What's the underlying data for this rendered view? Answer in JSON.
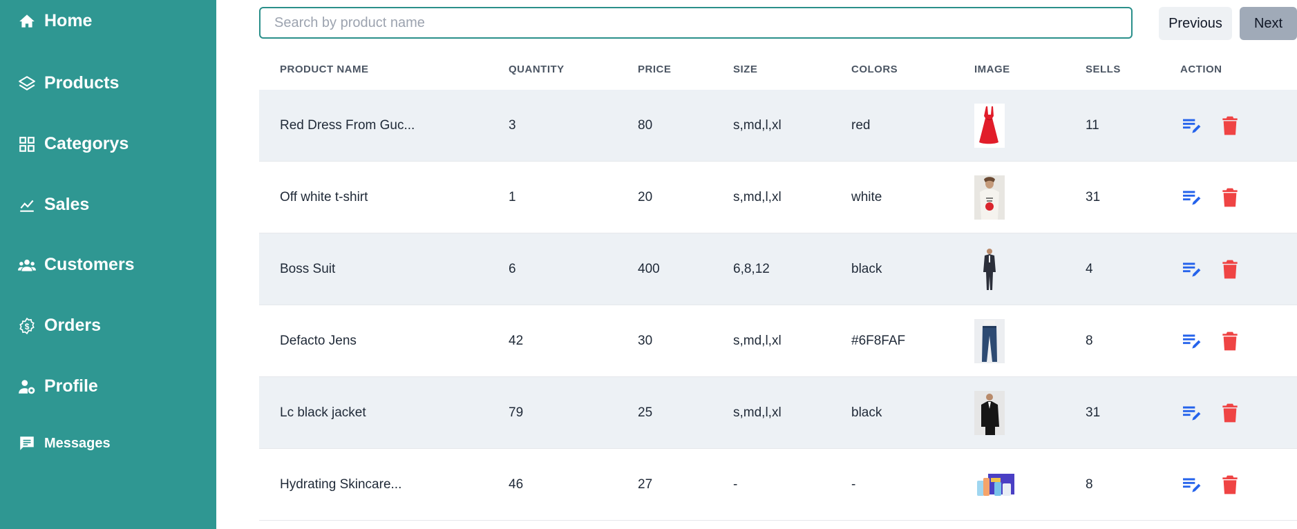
{
  "sidebar": {
    "items": [
      {
        "label": "Home",
        "icon": "home-icon"
      },
      {
        "label": "Products",
        "icon": "layers-icon"
      },
      {
        "label": "Categorys",
        "icon": "grid-icon"
      },
      {
        "label": "Sales",
        "icon": "chart-line-icon"
      },
      {
        "label": "Customers",
        "icon": "users-icon"
      },
      {
        "label": "Orders",
        "icon": "dollar-badge-icon"
      },
      {
        "label": "Profile",
        "icon": "user-gear-icon"
      },
      {
        "label": "Messages",
        "icon": "chat-icon"
      }
    ],
    "colors": {
      "background": "#2f9792",
      "text": "#ffffff"
    }
  },
  "search": {
    "placeholder": "Search by product name",
    "value": ""
  },
  "pagination": {
    "previous_label": "Previous",
    "next_label": "Next"
  },
  "table": {
    "headers": {
      "name": "PRODUCT NAME",
      "quantity": "QUANTITY",
      "price": "PRICE",
      "size": "SIZE",
      "colors": "COLORS",
      "image": "IMAGE",
      "sells": "SELLS",
      "action": "ACTION"
    },
    "rows": [
      {
        "name": "Red Dress From Guc...",
        "quantity": "3",
        "price": "80",
        "size": "s,md,l,xl",
        "colors": "red",
        "sells": "11",
        "image": "red-dress-image"
      },
      {
        "name": "Off white t-shirt",
        "quantity": "1",
        "price": "20",
        "size": "s,md,l,xl",
        "colors": "white",
        "sells": "31",
        "image": "tshirt-image"
      },
      {
        "name": "Boss Suit",
        "quantity": "6",
        "price": "400",
        "size": "6,8,12",
        "colors": "black",
        "sells": "4",
        "image": "suit-image"
      },
      {
        "name": "Defacto Jens",
        "quantity": "42",
        "price": "30",
        "size": "s,md,l,xl",
        "colors": "#6F8FAF",
        "sells": "8",
        "image": "jeans-image"
      },
      {
        "name": "Lc black jacket",
        "quantity": "79",
        "price": "25",
        "size": "s,md,l,xl",
        "colors": "black",
        "sells": "31",
        "image": "jacket-image"
      },
      {
        "name": "Hydrating Skincare...",
        "quantity": "46",
        "price": "27",
        "size": "-",
        "colors": "-",
        "sells": "8",
        "image": "skincare-image"
      }
    ],
    "colors": {
      "edit": "#2563eb",
      "delete": "#ef4444",
      "row_alt": "#edf1f5"
    }
  }
}
